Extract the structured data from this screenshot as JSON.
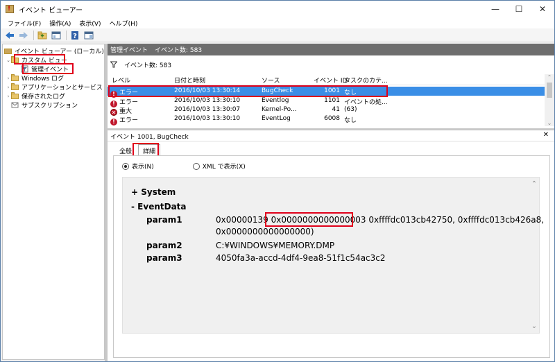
{
  "window": {
    "title": "イベント ビューアー"
  },
  "menu": [
    "ファイル(F)",
    "操作(A)",
    "表示(V)",
    "ヘルプ(H)"
  ],
  "tree": {
    "root": "イベント ビューアー (ローカル)",
    "custom_view": "カスタム ビュー",
    "admin_events": "管理イベント",
    "windows_logs": "Windows ログ",
    "app_service_logs": "アプリケーションとサービス ログ",
    "saved_logs": "保存されたログ",
    "subscriptions": "サブスクリプション"
  },
  "events_pane": {
    "header_title": "管理イベント",
    "header_count": "イベント数: 583",
    "filter_count": "イベント数: 583",
    "columns": [
      "レベル",
      "日付と時刻",
      "ソース",
      "イベント ID",
      "タスクのカテ..."
    ],
    "rows": [
      {
        "level": "エラー",
        "datetime": "2016/10/03 13:30:14",
        "source": "BugCheck",
        "id": "1001",
        "category": "なし"
      },
      {
        "level": "エラー",
        "datetime": "2016/10/03 13:30:10",
        "source": "Eventlog",
        "id": "1101",
        "category": "イベントの処..."
      },
      {
        "level": "重大",
        "datetime": "2016/10/03 13:30:07",
        "source": "Kernel-Po...",
        "id": "41",
        "category": "(63)"
      },
      {
        "level": "エラー",
        "datetime": "2016/10/03 13:30:10",
        "source": "EventLog",
        "id": "6008",
        "category": "なし"
      }
    ]
  },
  "detail": {
    "title": "イベント 1001, BugCheck",
    "tabs": [
      "全般",
      "詳細"
    ],
    "radio_friendly": "表示(N)",
    "radio_xml": "XML で表示(X)",
    "system_label": "System",
    "eventdata_label": "EventData",
    "params": [
      {
        "name": "param1",
        "prefix": "0x00000139",
        "highlight": "0x0000000000000003",
        "rest": "0xffffdc013cb42750, 0xffffdc013cb426a8,",
        "line2": "0x0000000000000000)"
      },
      {
        "name": "param2",
        "value": "C:¥WINDOWS¥MEMORY.DMP"
      },
      {
        "name": "param3",
        "value": "4050fa3a-accd-4df4-9ea8-51f1c54ac3c2"
      }
    ]
  }
}
